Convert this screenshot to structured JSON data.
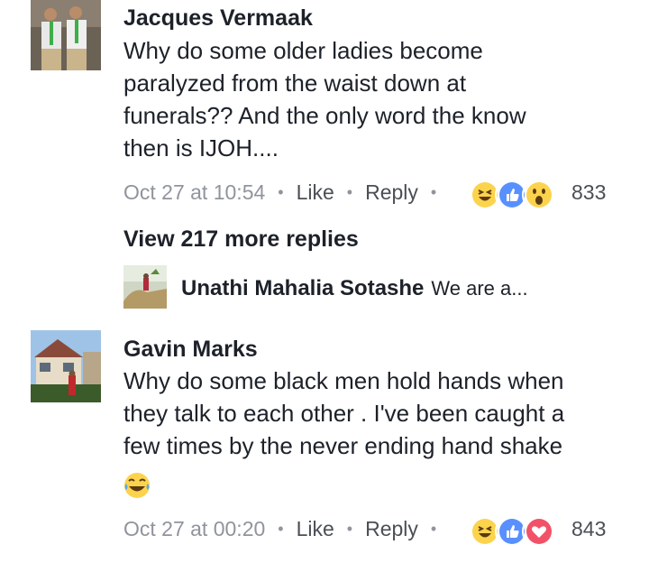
{
  "comments": [
    {
      "author": "Jacques Vermaak",
      "lines": [
        "Why do some older ladies become",
        "paralyzed from the waist down at",
        "funerals?? And the only word the know",
        "then is IJOH...."
      ],
      "timestamp": "Oct 27 at 10:54",
      "like_label": "Like",
      "reply_label": "Reply",
      "reaction_icons": [
        "haha-icon",
        "like-icon",
        "wow-icon"
      ],
      "reaction_count": "833"
    },
    {
      "author": "Gavin Marks",
      "lines": [
        "Why do some black men hold hands when",
        "they talk to each other . I've been caught a",
        "few times by the never ending hand shake"
      ],
      "inline_emoji": "laughing-tears-emoji",
      "timestamp": "Oct 27 at 00:20",
      "like_label": "Like",
      "reply_label": "Reply",
      "reaction_icons": [
        "haha-icon",
        "like-icon",
        "love-icon"
      ],
      "reaction_count": "843"
    }
  ],
  "view_more_replies": "View 217 more replies",
  "reply_preview": {
    "author": "Unathi Mahalia Sotashe",
    "text": "We are a..."
  },
  "colors": {
    "text": "#1d2129",
    "meta": "#90949c",
    "like_blue": "#5890ff",
    "love_red": "#f25268",
    "haha_yellow": "#fcd34d"
  }
}
